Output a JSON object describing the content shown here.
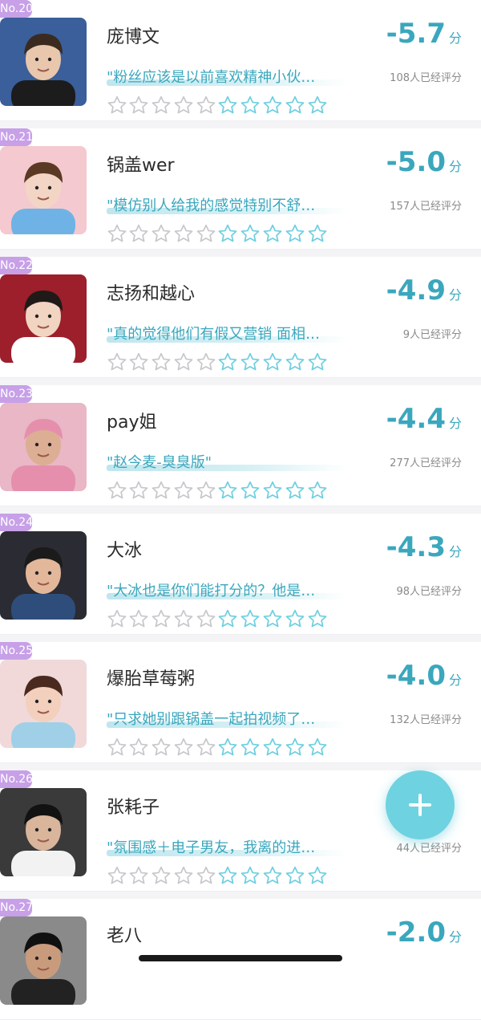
{
  "colors": {
    "accent": "#3aa7bd",
    "rank_badge": "#c7a0e8",
    "star_outline_left": "#c8c8cc",
    "star_outline_right": "#6fcfe0",
    "fab": "#6fd2e0"
  },
  "items": [
    {
      "rank": "No.20",
      "name": "庞博文",
      "quote": "\"粉丝应该是以前喜欢精神小伙…",
      "score": "-5.7",
      "unit": "分",
      "count": "108人已经评分",
      "avatar_bg": "#3a5f9a",
      "avatar_skin": "#e9c7ad",
      "avatar_hair": "#3b2a20",
      "avatar_shirt": "#1c1c1c"
    },
    {
      "rank": "No.21",
      "name": "锅盖wer",
      "quote": "\"模仿别人给我的感觉特别不舒…",
      "score": "-5.0",
      "unit": "分",
      "count": "157人已经评分",
      "avatar_bg": "#f4c9cf",
      "avatar_skin": "#f3d5c6",
      "avatar_hair": "#5a3a24",
      "avatar_shirt": "#6fb3e6"
    },
    {
      "rank": "No.22",
      "name": "志扬和越心",
      "quote": "\"真的觉得他们有假又营销 面相…",
      "score": "-4.9",
      "unit": "分",
      "count": "9人已经评分",
      "avatar_bg": "#9c1f2b",
      "avatar_skin": "#f1d4c2",
      "avatar_hair": "#1f1a18",
      "avatar_shirt": "#ffffff"
    },
    {
      "rank": "No.23",
      "name": "pay姐",
      "quote": "\"赵今麦-臭臭版\"",
      "score": "-4.4",
      "unit": "分",
      "count": "277人已经评分",
      "avatar_bg": "#e9b7c6",
      "avatar_skin": "#dcae93",
      "avatar_hair": "#e58fad",
      "avatar_shirt": "#e58fad"
    },
    {
      "rank": "No.24",
      "name": "大冰",
      "quote": "\"大冰也是你们能打分的？他是…",
      "score": "-4.3",
      "unit": "分",
      "count": "98人已经评分",
      "avatar_bg": "#2b2b33",
      "avatar_skin": "#e3b79a",
      "avatar_hair": "#1b1b1b",
      "avatar_shirt": "#2e4d7a"
    },
    {
      "rank": "No.25",
      "name": "爆胎草莓粥",
      "quote": "\"只求她别跟锅盖一起拍视频了…",
      "score": "-4.0",
      "unit": "分",
      "count": "132人已经评分",
      "avatar_bg": "#f1d9d9",
      "avatar_skin": "#f2d0bd",
      "avatar_hair": "#4a2a1e",
      "avatar_shirt": "#9fd0e8"
    },
    {
      "rank": "No.26",
      "name": "张耗子",
      "quote": "\"氛围感＋电子男友，我离的进…",
      "score": "",
      "unit": "",
      "count": "44人已经评分",
      "avatar_bg": "#3a3a3a",
      "avatar_skin": "#d9b59c",
      "avatar_hair": "#121212",
      "avatar_shirt": "#f2f2f2"
    },
    {
      "rank": "No.27",
      "name": "老八",
      "quote": "",
      "score": "-2.0",
      "unit": "分",
      "count": "",
      "avatar_bg": "#8a8a8a",
      "avatar_skin": "#c99b7d",
      "avatar_hair": "#101010",
      "avatar_shirt": "#222222"
    }
  ],
  "fab": {
    "icon": "plus-icon"
  }
}
